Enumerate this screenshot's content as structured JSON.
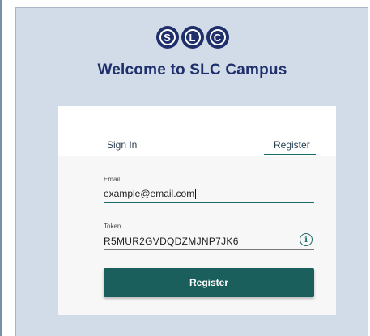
{
  "logo": {
    "letters": [
      "S",
      "L",
      "C"
    ],
    "color": "#1f2f6b"
  },
  "header": {
    "title": "Welcome to SLC Campus"
  },
  "tabs": [
    {
      "label": "Sign In",
      "active": false
    },
    {
      "label": "Register",
      "active": true
    }
  ],
  "form": {
    "email": {
      "label": "Email",
      "value": "example@email.com"
    },
    "token": {
      "label": "Token",
      "value": "R5MUR2GVDQDZMJNP7JK6",
      "icon": "info-icon"
    },
    "submit_label": "Register"
  },
  "colors": {
    "accent": "#1b6b68",
    "button": "#1b5f5c",
    "background": "#d2dce9",
    "brand": "#1f2f6b"
  }
}
